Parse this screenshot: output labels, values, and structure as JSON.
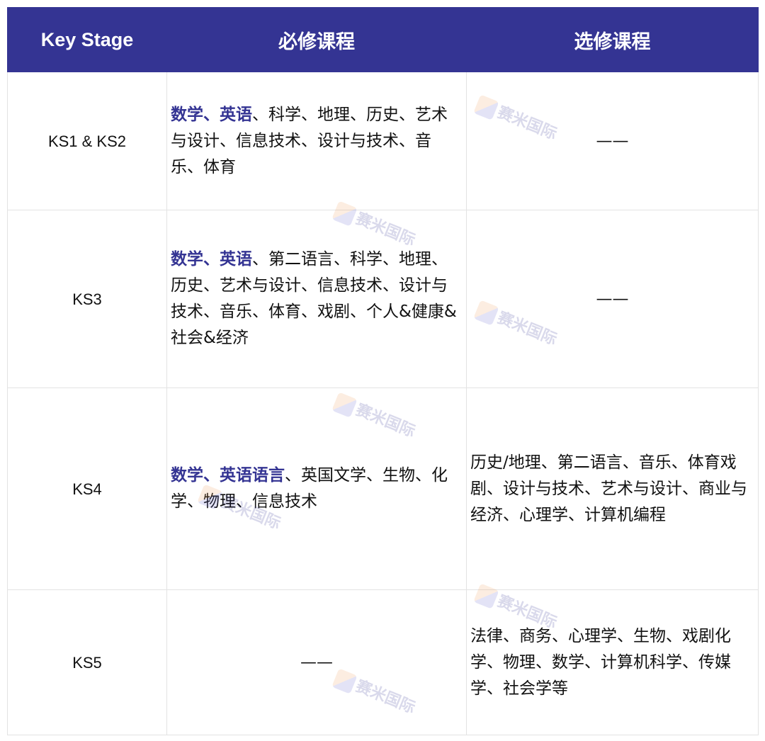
{
  "header": {
    "col1": "Key Stage",
    "col2": "必修课程",
    "col3": "选修课程"
  },
  "watermark": {
    "text": "赛米国际"
  },
  "rows": [
    {
      "stage": "KS1 & KS2",
      "required_highlight": "数学、英语",
      "required_rest": "、科学、地理、历史、艺术与设计、信息技术、设计与技术、音乐、体育",
      "elective": "——"
    },
    {
      "stage": "KS3",
      "required_highlight": "数学、英语",
      "required_rest": "、第二语言、科学、地理、历史、艺术与设计、信息技术、设计与技术、音乐、体育、戏剧、个人&健康&社会&经济",
      "elective": "——"
    },
    {
      "stage": "KS4",
      "required_highlight": "数学、英语语言",
      "required_rest": "、英国文学、生物、化学、物理、信息技术",
      "elective": "历史/地理、第二语言、音乐、体育戏剧、设计与技术、艺术与设计、商业与经济、心理学、计算机编程"
    },
    {
      "stage": "KS5",
      "required_highlight": "",
      "required_rest": "——",
      "elective": "法律、商务、心理学、生物、戏剧化学、物理、数学、计算机科学、传媒学、社会学等"
    }
  ]
}
